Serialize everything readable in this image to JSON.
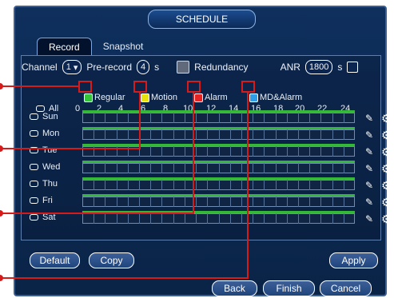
{
  "window": {
    "title": "SCHEDULE"
  },
  "tabs": [
    {
      "label": "Record"
    },
    {
      "label": "Snapshot"
    }
  ],
  "controls": {
    "channel_label": "Channel",
    "channel_value": "1",
    "prerecord_label": "Pre-record",
    "prerecord_value": "4",
    "prerecord_unit": "s",
    "redundancy_label": "Redundancy",
    "anr_label": "ANR",
    "anr_value": "1800",
    "anr_unit": "s"
  },
  "legend": [
    {
      "label": "Regular",
      "color": "#33c43a"
    },
    {
      "label": "Motion",
      "color": "#e8e20c"
    },
    {
      "label": "Alarm",
      "color": "#e52424"
    },
    {
      "label": "MD&Alarm",
      "color": "#2f9de6"
    }
  ],
  "axis_labels": [
    "0",
    "2",
    "4",
    "6",
    "8",
    "10",
    "12",
    "14",
    "16",
    "18",
    "20",
    "22",
    "24"
  ],
  "all_label": "All",
  "days": [
    {
      "label": "Sun"
    },
    {
      "label": "Mon"
    },
    {
      "label": "Tue"
    },
    {
      "label": "Wed"
    },
    {
      "label": "Thu"
    },
    {
      "label": "Fri"
    },
    {
      "label": "Sat"
    }
  ],
  "buttons": {
    "default": "Default",
    "copy": "Copy",
    "apply": "Apply",
    "back": "Back",
    "finish": "Finish",
    "cancel": "Cancel"
  }
}
